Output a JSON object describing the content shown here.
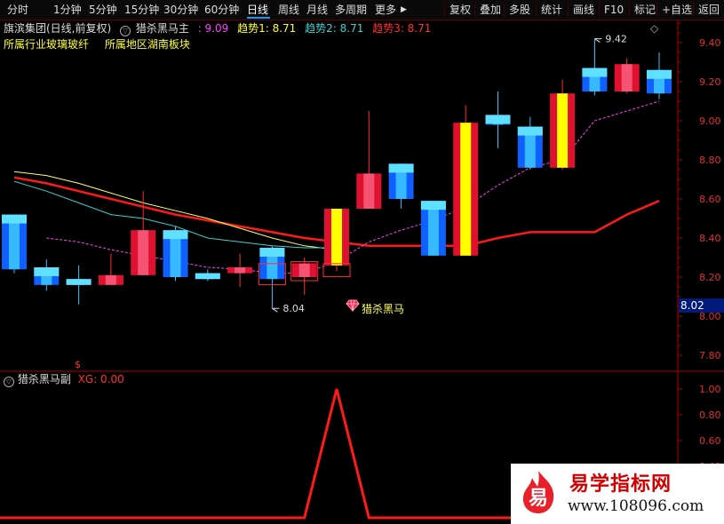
{
  "toolbar": {
    "periods": [
      "分时",
      "1分钟",
      "5分钟",
      "15分钟",
      "30分钟",
      "60分钟",
      "日线",
      "周线",
      "月线",
      "多周期",
      "更多"
    ],
    "active_period": "日线",
    "more_arrow": "▶",
    "actions": [
      "复权",
      "叠加",
      "多股",
      "统计",
      "画线",
      "F10",
      "标记",
      "+自选",
      "返回"
    ]
  },
  "main_info": {
    "stock": "旗滨集团(日线,前复权)",
    "indicator": "猎杀黑马主",
    "value_main": ": 9.09",
    "trend1": "趋势1: 8.71",
    "trend2": "趋势2: 8.71",
    "trend3": "趋势3: 8.71",
    "diamond": "◇",
    "arrow": "▽"
  },
  "sector_info": {
    "industry": "所属行业玻璃玻纤",
    "region": "所属地区湖南板块"
  },
  "sub_info": {
    "indicator": "猎杀黑马副",
    "xg": "XG: 0.00"
  },
  "annotations": {
    "high_label": "9.42",
    "low_label": "8.04",
    "signal_label": "猎杀黑马",
    "signal_icon": "diamond-gem",
    "dollar": "$"
  },
  "current_price": "8.02",
  "watermark": {
    "logo_char": "易",
    "title": "易学指标网",
    "url": "www.108096.com"
  },
  "colors": {
    "up": "#ff2020",
    "down": "#20a0ff",
    "up_yellow": "#ffff00",
    "trend_red": "#ff1a1a",
    "trend_magenta": "#ff40ff",
    "line_yellow": "#ffff66",
    "line_cyan": "#40d0d0"
  },
  "chart_data": [
    {
      "type": "candlestick",
      "title": "猎杀黑马主",
      "ylim": [
        7.72,
        9.55
      ],
      "yticks": [
        7.8,
        8.0,
        8.2,
        8.4,
        8.6,
        8.8,
        9.0,
        9.2,
        9.4
      ],
      "candles": [
        {
          "o": 8.52,
          "c": 8.24,
          "h": 8.52,
          "l": 8.22
        },
        {
          "o": 8.25,
          "c": 8.16,
          "h": 8.29,
          "l": 8.13
        },
        {
          "o": 8.19,
          "c": 8.16,
          "h": 8.26,
          "l": 8.06
        },
        {
          "o": 8.16,
          "c": 8.21,
          "h": 8.32,
          "l": 8.16
        },
        {
          "o": 8.21,
          "c": 8.44,
          "h": 8.64,
          "l": 8.21
        },
        {
          "o": 8.44,
          "c": 8.2,
          "h": 8.46,
          "l": 8.18
        },
        {
          "o": 8.22,
          "c": 8.19,
          "h": 8.24,
          "l": 8.18
        },
        {
          "o": 8.22,
          "c": 8.25,
          "h": 8.32,
          "l": 8.15
        },
        {
          "o": 8.35,
          "c": 8.19,
          "h": 8.36,
          "l": 8.04
        },
        {
          "o": 8.2,
          "c": 8.27,
          "h": 8.3,
          "l": 8.11
        },
        {
          "o": 8.26,
          "c": 8.55,
          "h": 8.55,
          "l": 8.23
        },
        {
          "o": 8.55,
          "c": 8.73,
          "h": 9.05,
          "l": 8.55
        },
        {
          "o": 8.78,
          "c": 8.6,
          "h": 8.78,
          "l": 8.55
        },
        {
          "o": 8.59,
          "c": 8.31,
          "h": 8.59,
          "l": 8.31
        },
        {
          "o": 8.31,
          "c": 8.99,
          "h": 9.08,
          "l": 8.31
        },
        {
          "o": 9.03,
          "c": 8.98,
          "h": 9.15,
          "l": 8.86
        },
        {
          "o": 8.97,
          "c": 8.76,
          "h": 9.02,
          "l": 8.75
        },
        {
          "o": 8.76,
          "c": 9.14,
          "h": 9.21,
          "l": 8.75
        },
        {
          "o": 9.27,
          "c": 9.15,
          "h": 9.42,
          "l": 9.13
        },
        {
          "o": 9.15,
          "c": 9.29,
          "h": 9.32,
          "l": 9.14
        },
        {
          "o": 9.26,
          "c": 9.14,
          "h": 9.35,
          "l": 9.11
        }
      ],
      "series": [
        {
          "color": "red",
          "values": [
            8.71,
            8.68,
            8.64,
            8.6,
            8.56,
            8.52,
            8.49,
            8.46,
            8.43,
            8.4,
            8.38,
            8.36,
            8.36,
            8.36,
            8.36,
            8.4,
            8.43,
            8.43,
            8.43,
            8.52,
            8.59
          ]
        },
        {
          "color": "yellow",
          "values": [
            8.74,
            8.72,
            8.68,
            8.63,
            8.58,
            8.54,
            8.5,
            8.45,
            8.4,
            8.36,
            8.34,
            null,
            null,
            null,
            null,
            null,
            null,
            null,
            null,
            null,
            null
          ]
        },
        {
          "color": "cyan",
          "values": [
            8.69,
            8.64,
            8.58,
            8.52,
            8.5,
            8.46,
            8.4,
            8.38,
            8.36,
            8.35,
            8.35,
            null,
            null,
            null,
            null,
            null,
            null,
            null,
            null,
            null,
            null
          ]
        },
        {
          "color": "magenta",
          "values": [
            null,
            8.4,
            8.38,
            8.34,
            8.31,
            8.28,
            8.25,
            8.24,
            8.22,
            8.22,
            8.28,
            8.38,
            8.44,
            8.49,
            8.56,
            8.67,
            8.76,
            8.8,
            9.0,
            9.05,
            9.1
          ]
        }
      ]
    },
    {
      "type": "line",
      "title": "猎杀黑马副",
      "ylim": [
        0,
        1.05
      ],
      "yticks": [
        0.0,
        0.2,
        0.4,
        0.6,
        0.8,
        1.0
      ],
      "series": [
        {
          "name": "XG",
          "values": [
            0,
            0,
            0,
            0,
            0,
            0,
            0,
            0,
            0,
            0,
            1,
            0,
            0,
            0,
            0,
            0,
            0,
            0,
            0,
            0,
            0
          ]
        }
      ]
    }
  ]
}
